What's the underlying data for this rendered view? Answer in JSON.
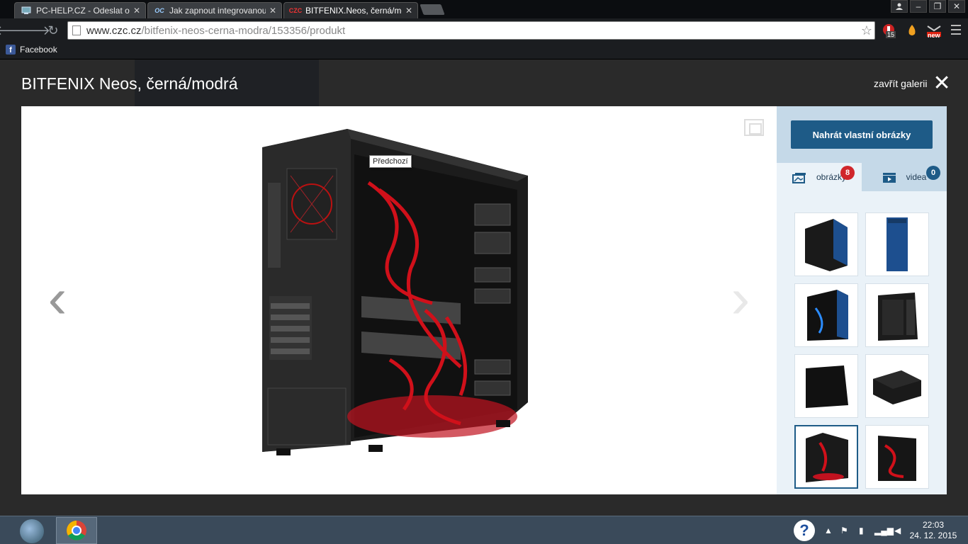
{
  "tabs": [
    {
      "title": "PC-HELP.CZ - Odeslat odp"
    },
    {
      "title": "Jak zapnout integrovanou"
    },
    {
      "title": "BITFENIX.Neos, černá/mod"
    }
  ],
  "tab_favicons": {
    "tab3": "CZC"
  },
  "address_bar": {
    "host": "www.czc.cz",
    "path": "/bitfenix-neos-cerna-modra/153356/produkt"
  },
  "extensions": {
    "badge_count": "15",
    "new_label": "new"
  },
  "bookmarks": [
    {
      "label": "Facebook"
    }
  ],
  "gallery": {
    "title": "BITFENIX Neos, černá/modrá",
    "close_label": "zavřít galerii",
    "upload_label": "Nahrát vlastní obrázky",
    "tooltip": "Předchozí",
    "tabs": [
      {
        "label": "obrázky",
        "count": "8"
      },
      {
        "label": "videa",
        "count": "0"
      }
    ],
    "thumbnails": [
      {
        "name": "case-black-blue-angle"
      },
      {
        "name": "case-blue-front"
      },
      {
        "name": "case-open-blue-lights"
      },
      {
        "name": "case-open-empty"
      },
      {
        "name": "case-black-side"
      },
      {
        "name": "case-lying-flat"
      },
      {
        "name": "case-open-red-build",
        "selected": true
      },
      {
        "name": "case-open-red-build-2"
      }
    ]
  },
  "taskbar": {
    "time": "22:03",
    "date": "24. 12. 2015"
  },
  "colors": {
    "accent": "#1e5b87",
    "badge_red": "#d0262b",
    "sidebar_bg": "#eaf2f8"
  }
}
